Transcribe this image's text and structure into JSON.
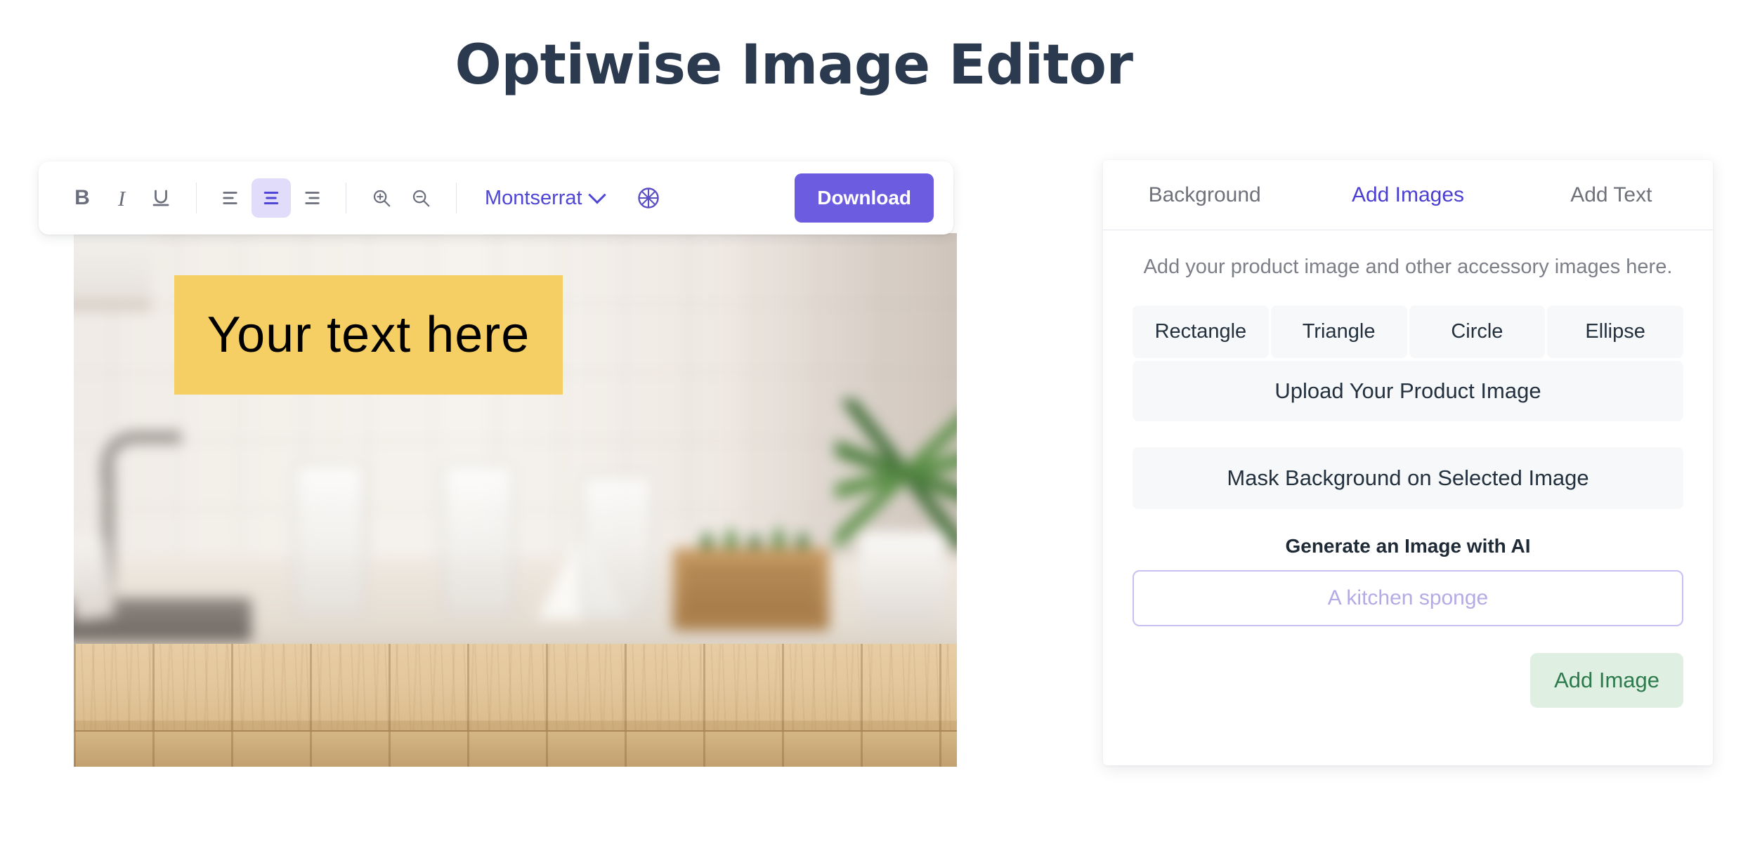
{
  "header": {
    "title": "Optiwise Image Editor"
  },
  "toolbar": {
    "bold_label": "B",
    "italic_label": "I",
    "underline_label": "U",
    "align_left_name": "align-left-icon",
    "align_center_name": "align-center-icon",
    "align_right_name": "align-right-icon",
    "zoom_in_name": "zoom-in-icon",
    "zoom_out_name": "zoom-out-icon",
    "font_name": "Montserrat",
    "color_wheel_name": "color-wheel-icon",
    "download_label": "Download",
    "active_alignment": "center",
    "accent_color": "#6c5ce0",
    "active_bg_color": "#e2dcfb"
  },
  "canvas": {
    "text_overlay": "Your text here",
    "text_box_color": "#f5cf63",
    "text_color": "#000000",
    "background_description": "blurred kitchen with wooden table"
  },
  "panel": {
    "tabs": [
      {
        "label": "Background",
        "active": false
      },
      {
        "label": "Add Images",
        "active": true
      },
      {
        "label": "Add Text",
        "active": false
      }
    ],
    "hint": "Add your product image and other accessory images here.",
    "shapes": [
      {
        "label": "Rectangle"
      },
      {
        "label": "Triangle"
      },
      {
        "label": "Circle"
      },
      {
        "label": "Ellipse"
      }
    ],
    "upload_label": "Upload Your Product Image",
    "mask_label": "Mask Background on Selected Image",
    "ai_section_label": "Generate an Image with AI",
    "ai_prompt_placeholder": "A kitchen sponge",
    "ai_prompt_value": "",
    "add_image_label": "Add Image",
    "add_image_text_color": "#2d7a4c",
    "add_image_bg_color": "#dff0e3"
  }
}
